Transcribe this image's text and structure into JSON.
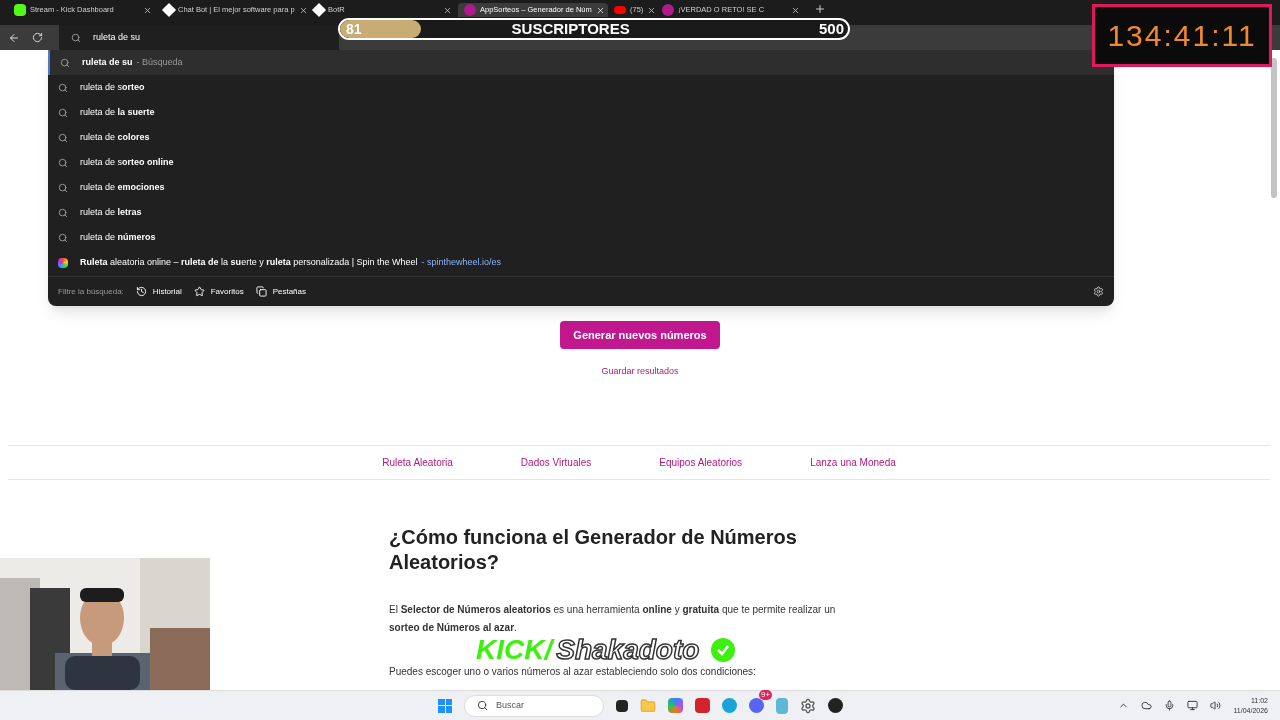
{
  "tabs": [
    {
      "title": "Stream - Kick Dashboard",
      "selected": false,
      "kind": "kick"
    },
    {
      "title": "Chat Bot | El mejor software para p",
      "selected": false,
      "kind": "bot"
    },
    {
      "title": "BotR",
      "selected": false,
      "kind": "bot"
    },
    {
      "title": "AppSorteos – Generador de Núm",
      "selected": true,
      "kind": "app"
    },
    {
      "title": "(75)",
      "selected": false,
      "kind": "video"
    },
    {
      "title": "¡VERDAD O RETO! SE C",
      "selected": false,
      "kind": "app"
    }
  ],
  "address": {
    "value": "ruleta de su"
  },
  "suggestions": [
    {
      "kind": "search",
      "text": "**ruleta de su**",
      "hint": "- Búsqueda",
      "selected": true
    },
    {
      "kind": "search",
      "text": "ruleta de s**orteo**",
      "selected": false
    },
    {
      "kind": "search",
      "text": "ruleta de **la suerte**",
      "selected": false
    },
    {
      "kind": "search",
      "text": "ruleta de **colores**",
      "selected": false
    },
    {
      "kind": "search",
      "text": "ruleta de s**orteo online**",
      "selected": false
    },
    {
      "kind": "search",
      "text": "ruleta de **emociones**",
      "selected": false
    },
    {
      "kind": "search",
      "text": "ruleta de **letras**",
      "selected": false
    },
    {
      "kind": "search",
      "text": "ruleta de **números**",
      "selected": false
    },
    {
      "kind": "site",
      "text": "**Ruleta** aleatoria online – **ruleta de** la **su**erte y **ruleta** personalizada | Spin the Wheel",
      "hint": "- spinthewheel.io/es",
      "selected": false
    }
  ],
  "filter": {
    "label": "Filtre la búsqueda:",
    "options": [
      {
        "kind": "history",
        "label": "Historial"
      },
      {
        "kind": "star",
        "label": "Favoritos"
      },
      {
        "kind": "tabs",
        "label": "Pestañas"
      }
    ]
  },
  "page": {
    "button": "Generar nuevos números",
    "save_link": "Guardar resultados",
    "nav": [
      "Ruleta Aleatoria",
      "Dados Virtuales",
      "Equipos Aleatorios",
      "Lanza una Moneda"
    ],
    "heading": "¿Cómo funciona el Generador de Números Aleatorios?",
    "paragraphs": [
      "El **Selector de Números aleatorios** es una herramienta **online** y **gratuita** que te permite realizar un **sorteo de Números al azar**.",
      "Puedes escoger uno o varios números al azar estableciendo solo dos condiciones:"
    ]
  },
  "overlay": {
    "subs": {
      "count": "81",
      "label": "SUSCRIPTORES",
      "goal": "500",
      "level": 0.16
    },
    "timer": "134:41:11",
    "banner": {
      "kick": "KICK/",
      "name": "Shakadoto"
    }
  },
  "taskbar": {
    "search": "Buscar",
    "badge": "9+",
    "time": "11:02",
    "date": "11/04/2026"
  }
}
